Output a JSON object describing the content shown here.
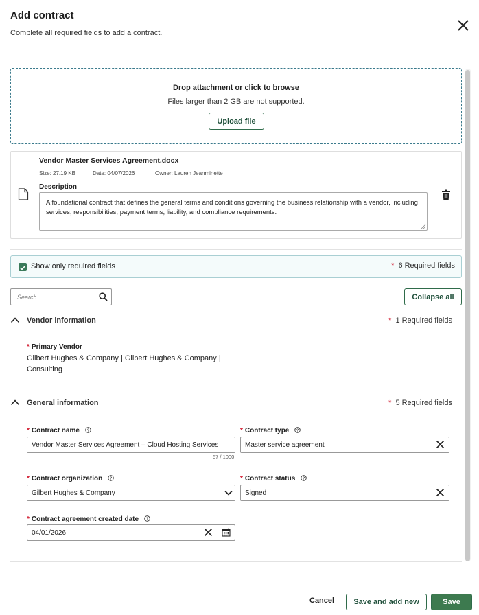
{
  "dialog": {
    "title": "Add contract",
    "subtitle": "Complete all required fields to add a contract."
  },
  "dropzone": {
    "title": "Drop attachment or click to browse",
    "note": "Files larger than 2 GB are not supported.",
    "upload_label": "Upload file"
  },
  "file": {
    "name": "Vendor Master Services Agreement.docx",
    "size": "Size: 27.19 KB",
    "date": "Date: 04/07/2026",
    "owner": "Owner: Lauren Jeanminette",
    "description_label": "Description",
    "description": "A foundational contract that defines the general terms and conditions governing the business relationship with a vendor, including services, responsibilities, payment terms, liability, and compliance requirements."
  },
  "filter": {
    "show_required_label": "Show only required fields",
    "show_required_checked": true,
    "required_count": "6 Required fields",
    "search_placeholder": "Search",
    "collapse_label": "Collapse all"
  },
  "sections": {
    "vendor": {
      "title": "Vendor information",
      "required": "1 Required fields",
      "primary_vendor_label": "Primary Vendor",
      "primary_vendor_value": "Gilbert Hughes & Company | Gilbert Hughes & Company | Consulting"
    },
    "general": {
      "title": "General information",
      "required": "5 Required fields",
      "contract_name_label": "Contract name",
      "contract_name_value": "Vendor Master Services Agreement – Cloud Hosting Services",
      "contract_name_counter": "57 / 1000",
      "contract_type_label": "Contract type",
      "contract_type_value": "Master service agreement",
      "contract_org_label": "Contract organization",
      "contract_org_value": "Gilbert Hughes & Company",
      "contract_status_label": "Contract status",
      "contract_status_value": "Signed",
      "created_date_label": "Contract agreement created date",
      "created_date_value": "04/01/2026"
    }
  },
  "footer": {
    "cancel_label": "Cancel",
    "save_new_label": "Save and add new",
    "save_label": "Save"
  },
  "colors": {
    "accent_green": "#3d7a4f",
    "required_star": "#d0152a",
    "dropzone_border": "#3a7a8c"
  }
}
